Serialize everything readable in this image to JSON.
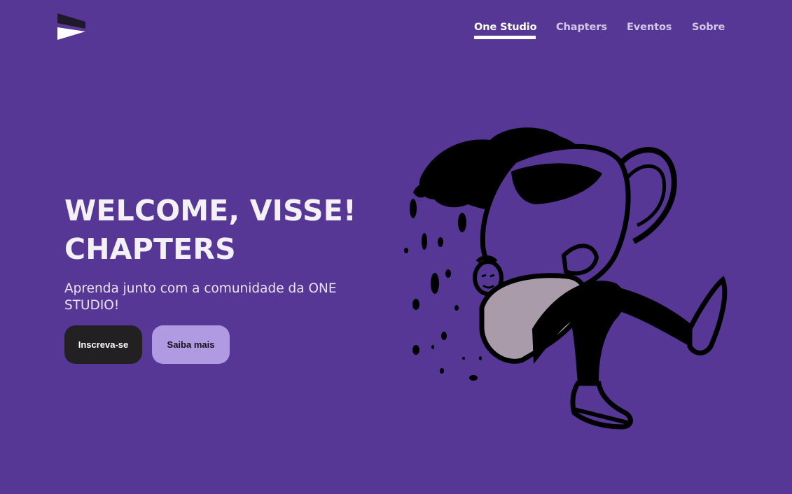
{
  "header": {
    "logo_icon": "play-wedge-logo",
    "nav": [
      {
        "label": "One Studio",
        "active": true
      },
      {
        "label": "Chapters",
        "active": false
      },
      {
        "label": "Eventos",
        "active": false
      },
      {
        "label": "Sobre",
        "active": false
      }
    ]
  },
  "hero": {
    "title_line1": "WELCOME, VISSE!",
    "title_line2": "CHAPTERS",
    "subtitle": "Aprenda junto com a comunidade da ONE STUDIO!",
    "primary_button": "Inscreva-se",
    "secondary_button": "Saiba mais"
  },
  "illustration": {
    "icon": "person-carrying-cup-illustration"
  },
  "colors": {
    "background": "#563795",
    "primary_button": "#232023",
    "secondary_button": "#b09ae2",
    "text": "#f3f0f8"
  }
}
